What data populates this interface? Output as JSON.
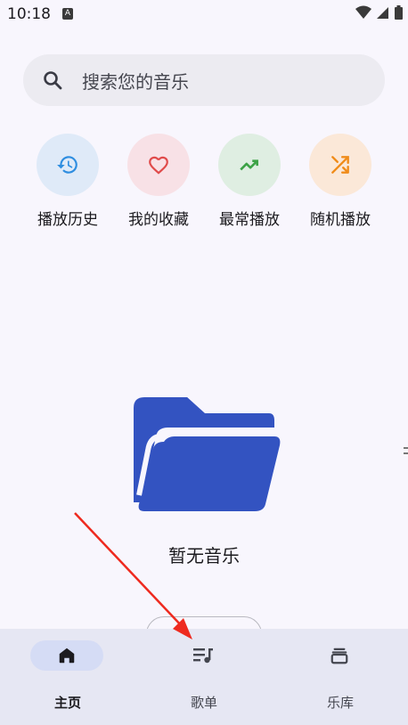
{
  "status_bar": {
    "time": "10:18",
    "badge": "A"
  },
  "search": {
    "placeholder": "搜索您的音乐",
    "icon": "search-icon"
  },
  "quick_actions": [
    {
      "label": "播放历史",
      "icon": "history-icon",
      "bg": "#dfeaf8",
      "color": "#2f8ee0"
    },
    {
      "label": "我的收藏",
      "icon": "heart-icon",
      "bg": "#f8e1e6",
      "color": "#e04a4a"
    },
    {
      "label": "最常播放",
      "icon": "trending-up-icon",
      "bg": "#dfeee2",
      "color": "#3ca246"
    },
    {
      "label": "随机播放",
      "icon": "shuffle-icon",
      "bg": "#fbe8d8",
      "color": "#f08c1a"
    }
  ],
  "empty_state": {
    "text": "暂无音乐",
    "icon": "folder-open-icon",
    "color": "#3353c1"
  },
  "bottom_nav": [
    {
      "label": "主页",
      "icon": "home-icon",
      "active": true
    },
    {
      "label": "歌单",
      "icon": "playlist-icon",
      "active": false
    },
    {
      "label": "乐库",
      "icon": "library-icon",
      "active": false
    }
  ],
  "annotation": {
    "color": "#ee2a1f"
  }
}
